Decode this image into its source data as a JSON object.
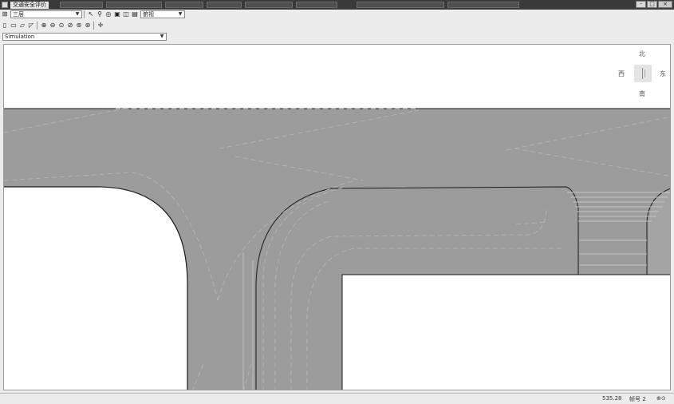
{
  "window": {
    "title": "交通安全评价",
    "controls": {
      "minimize": "-",
      "maximize": "□",
      "close": "×"
    }
  },
  "toolbar1": {
    "layer_combo": "三层",
    "view_combo": "俯视"
  },
  "toolbar3": {
    "sim_combo": "Simulation"
  },
  "compass": {
    "north": "北",
    "south": "南",
    "east": "东",
    "west": "西"
  },
  "status": {
    "coords": "535.28",
    "frame": "帧号 2",
    "mode": "⊕⊙"
  },
  "colors": {
    "road": "#9c9c9c",
    "ground": "#ffffff",
    "curb": "#1a1a1a",
    "lane_mark": "#b8b8b8"
  }
}
